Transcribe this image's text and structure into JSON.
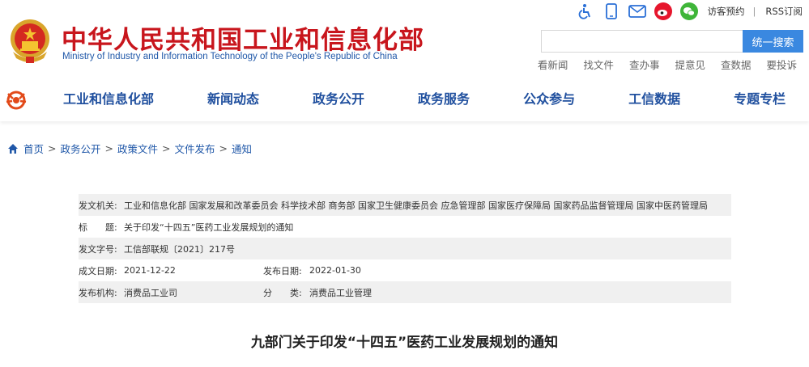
{
  "site": {
    "title": "中华人民共和国工业和信息化部",
    "subtitle": "Ministry of Industry and Information Technology of the People's Republic of China"
  },
  "toolbar": {
    "icons": [
      "accessibility-icon",
      "mobile-icon",
      "mail-icon",
      "weibo-icon",
      "wechat-icon"
    ],
    "visitor_label": "访客预约",
    "separator": "|",
    "rss_label": "RSS订阅"
  },
  "search": {
    "placeholder": "",
    "button_label": "统一搜索"
  },
  "quick_links": [
    "看新闻",
    "找文件",
    "查办事",
    "提意见",
    "查数据",
    "要投诉"
  ],
  "nav": {
    "items": [
      "工业和信息化部",
      "新闻动态",
      "政务公开",
      "政务服务",
      "公众参与",
      "工信数据",
      "专题专栏"
    ]
  },
  "breadcrumb": {
    "items": [
      "首页",
      "政务公开",
      "政策文件",
      "文件发布",
      "通知"
    ],
    "separator": ">"
  },
  "info": {
    "issuer_label": "发文机关:",
    "issuer": "工业和信息化部 国家发展和改革委员会 科学技术部 商务部 国家卫生健康委员会 应急管理部 国家医疗保障局 国家药品监督管理局 国家中医药管理局",
    "title_label": "标　　题:",
    "title": "关于印发“十四五”医药工业发展规划的通知",
    "number_label": "发文字号:",
    "number": "工信部联规〔2021〕217号",
    "created_label": "成文日期:",
    "created": "2021-12-22",
    "published_label": "发布日期:",
    "published": "2022-01-30",
    "agency_label": "发布机构:",
    "agency": "消费品工业司",
    "category_label": "分　　类:",
    "category": "消费品工业管理"
  },
  "document": {
    "heading": "九部门关于印发“十四五”医药工业发展规划的通知"
  },
  "colors": {
    "brand_red": "#c8161d",
    "nav_blue": "#1f4f9e",
    "search_button": "#3a88e0",
    "icon_blue": "#2a6fd6",
    "weibo_red": "#e6162d",
    "wechat_green": "#3fb539"
  }
}
